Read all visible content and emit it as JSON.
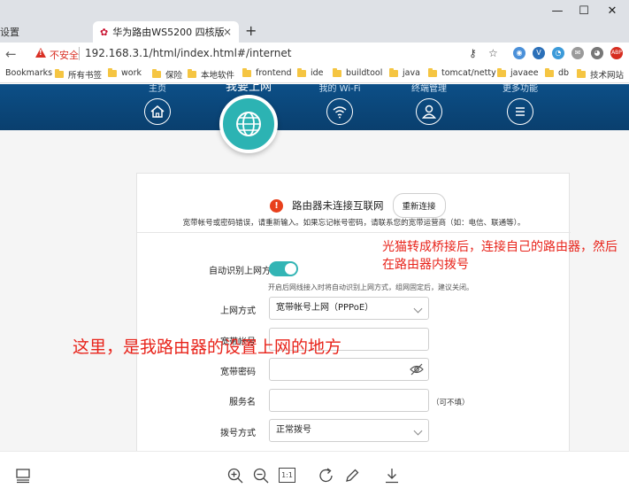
{
  "browser": {
    "tabs": [
      {
        "label": "设置",
        "active": false
      },
      {
        "label": "华为路由WS5200 四核版",
        "active": true,
        "favicon": "huawei-icon"
      }
    ],
    "new_tab_label": "+",
    "close_label": "×",
    "window_controls": {
      "minimize": "—",
      "maximize": "☐",
      "close": "✕"
    },
    "security_label": "不安全",
    "url": "192.168.3.1/html/index.html#/internet",
    "bookmarks_label": "Bookmarks",
    "bookmark_folders": [
      "所有书签",
      "work",
      "保险",
      "本地软件",
      "frontend",
      "ide",
      "buildtool",
      "java",
      "tomcat/netty",
      "javaee",
      "db",
      "技术网站"
    ],
    "extension_badges": {
      "abp": "ABP"
    }
  },
  "router": {
    "nav": [
      {
        "label": "主页",
        "icon": "home-icon"
      },
      {
        "label": "我要上网",
        "icon": "globe-icon",
        "active": true
      },
      {
        "label": "我的 Wi-Fi",
        "icon": "wifi-icon"
      },
      {
        "label": "终端管理",
        "icon": "user-icon"
      },
      {
        "label": "更多功能",
        "icon": "menu-icon"
      }
    ],
    "status": {
      "icon_glyph": "!",
      "message": "路由器未连接互联网",
      "reconnect_label": "重新连接",
      "hint": "宽带帐号或密码错误，请重新输入。如果忘记帐号密码，请联系您的宽带运营商（如：电信、联通等）。"
    },
    "form": {
      "auto_detect_label": "自动识别上网方式",
      "auto_detect_on": true,
      "auto_detect_hint": "开启后网线接入时将自动识别上网方式，组网固定后，建议关闭。",
      "mode_label": "上网方式",
      "mode_value": "宽带帐号上网（PPPoE）",
      "account_label": "宽带帐号",
      "account_value": "",
      "password_label": "宽带密码",
      "password_value": "",
      "service_label": "服务名",
      "service_value": "",
      "service_optional": "（可不填）",
      "dial_label": "拨号方式",
      "dial_value": "正常拨号"
    }
  },
  "annotations": {
    "right_line1": "光猫转成桥接后，连接自己的路由器，然后",
    "right_line2": "在路由器内拨号",
    "left": "这里，是我路由器的设置上网的地方"
  },
  "viewer_toolbar": {
    "icons": [
      "thumbnail-icon",
      "zoom-in-icon",
      "zoom-out-icon",
      "actual-size-icon",
      "rotate-icon",
      "edit-icon",
      "download-icon"
    ],
    "actual_size_label": "1:1"
  },
  "colors": {
    "router_header": "#0c4f87",
    "accent_teal": "#2cb3b3",
    "error": "#e8401c",
    "annotation": "#e8231a"
  }
}
